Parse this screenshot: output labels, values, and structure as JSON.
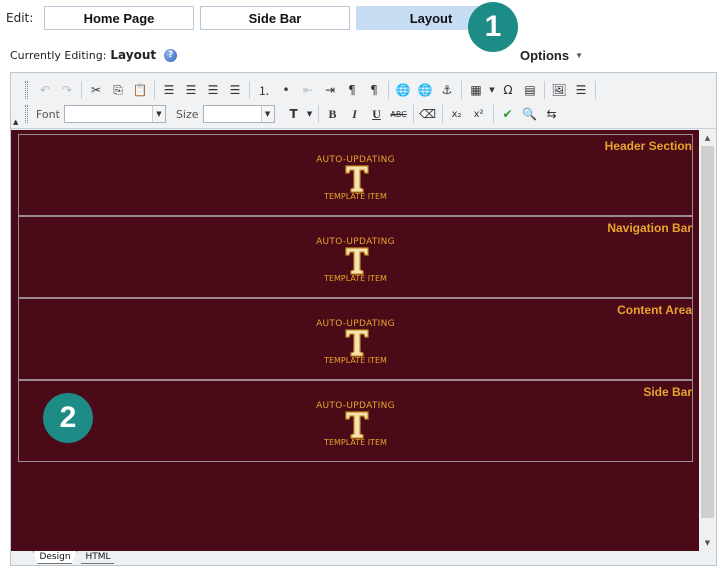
{
  "edit": {
    "label": "Edit:",
    "tabs": [
      {
        "label": "Home Page",
        "active": false
      },
      {
        "label": "Side Bar",
        "active": false
      },
      {
        "label": "Layout",
        "active": true
      }
    ]
  },
  "callouts": [
    "1",
    "2"
  ],
  "currently_editing": {
    "label": "Currently Editing:",
    "value": "Layout",
    "help_icon": "help-icon"
  },
  "options": {
    "label": "Options"
  },
  "toolbar": {
    "row1_icons": [
      "undo-icon",
      "redo-icon",
      "cut-icon",
      "copy-icon",
      "paste-icon",
      "align-left-icon",
      "align-center-icon",
      "align-right-icon",
      "justify-icon",
      "ordered-list-icon",
      "unordered-list-icon",
      "outdent-icon",
      "indent-icon",
      "ltr-icon",
      "rtl-icon",
      "hyperlink-icon",
      "remove-link-icon",
      "anchor-icon",
      "table-icon",
      "special-char-icon",
      "template-icon",
      "image-icon",
      "horizontal-rule-icon"
    ],
    "font_label": "Font",
    "size_label": "Size",
    "font_value": "",
    "size_value": ""
  },
  "sections": [
    {
      "title": "Header Section",
      "top_label": "AUTO-UPDATING",
      "bottom_label": "TEMPLATE ITEM"
    },
    {
      "title": "Navigation Bar",
      "top_label": "AUTO-UPDATING",
      "bottom_label": "TEMPLATE ITEM"
    },
    {
      "title": "Content Area",
      "top_label": "AUTO-UPDATING",
      "bottom_label": "TEMPLATE ITEM"
    },
    {
      "title": "Side Bar",
      "top_label": "AUTO-UPDATING",
      "bottom_label": "TEMPLATE ITEM"
    }
  ],
  "mode_tabs": [
    {
      "label": "Design",
      "active": true
    },
    {
      "label": "HTML",
      "active": false
    }
  ],
  "colors": {
    "canvas": "#4b0a17",
    "accent_text": "#e7a52c",
    "callout": "#1e8c86",
    "active_tab": "#c6dcf3"
  }
}
